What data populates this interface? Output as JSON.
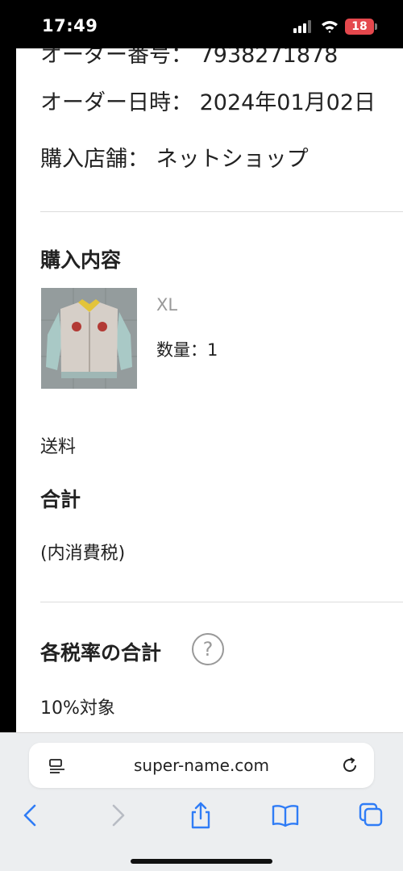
{
  "status_bar": {
    "time": "17:49",
    "battery_level": "18"
  },
  "order_info": {
    "order_number_cut": "オーダー番号： 7938271878",
    "order_datetime": "オーダー日時： 2024年01月02日",
    "purchase_store": "購入店舗： ネットショップ"
  },
  "purchase_contents": {
    "title": "購入内容",
    "items": [
      {
        "size": "XL",
        "quantity": "数量：1"
      }
    ]
  },
  "summary": {
    "shipping_label": "送料",
    "total_label": "合計",
    "tax_note": "(内消費税)"
  },
  "tax_rates": {
    "title": "各税率の合計",
    "help_symbol": "?",
    "rate_10_label": "10%対象"
  },
  "browser": {
    "url": "super-name.com"
  },
  "icons": {
    "page_menu": "page-menu-icon",
    "reload": "reload-icon",
    "back": "chevron-left-icon",
    "forward": "chevron-right-icon",
    "share": "share-icon",
    "bookmarks": "book-icon",
    "tabs": "tabs-icon"
  },
  "colors": {
    "ios_blue": "#2f7cf6",
    "battery_red": "#e5484d"
  }
}
